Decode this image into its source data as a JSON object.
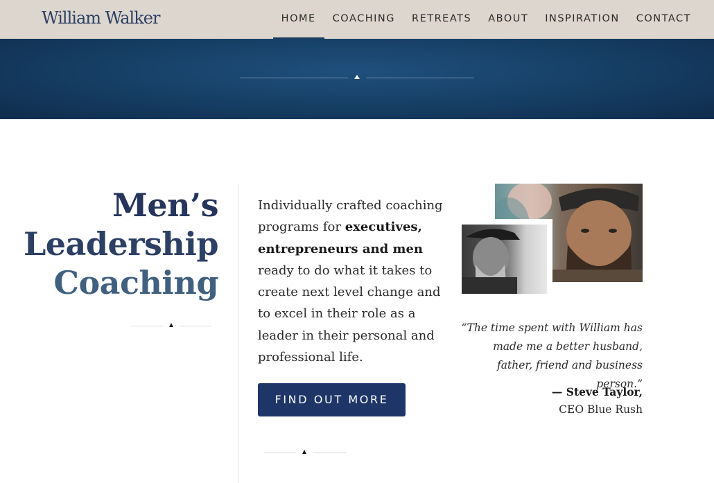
{
  "header": {
    "logo": "William Walker",
    "nav": [
      {
        "label": "HOME",
        "active": true
      },
      {
        "label": "COACHING"
      },
      {
        "label": "RETREATS"
      },
      {
        "label": "ABOUT"
      },
      {
        "label": "INSPIRATION"
      },
      {
        "label": "CONTACT"
      }
    ]
  },
  "hero": {
    "headline_line1": "Men’s",
    "headline_line2": "Leadership",
    "headline_line3": "Coaching"
  },
  "intro": {
    "text_before": "Individually crafted coaching programs for ",
    "bold": "executives, entrepreneurs and men",
    "text_after": " ready to do what it takes to create next level change and to excel in their role as a leader in their personal and professional life."
  },
  "cta": {
    "label": "FIND OUT MORE"
  },
  "testimonial": {
    "quote": "“The time spent with William has made me a better husband, father, friend and business person.”",
    "author": "— Steve Taylor,",
    "author_title": "CEO Blue Rush"
  },
  "colors": {
    "header_bg": "#ddd6ce",
    "banner_bg": "#174168",
    "brand_navy": "#2c3f64",
    "button_bg": "#1e3568"
  }
}
